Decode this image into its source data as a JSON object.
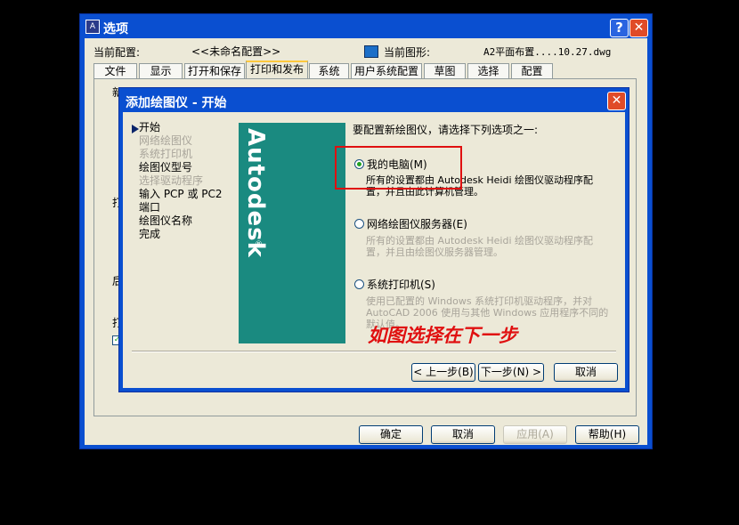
{
  "options_window": {
    "title": "选项",
    "help_btn": "?",
    "close_btn": "✕",
    "current_config_label": "当前配置:",
    "current_config_value": "<<未命名配置>>",
    "current_drawing_label": "当前图形:",
    "current_drawing_value": "A2平面布置....10.27.dwg",
    "tabs": [
      {
        "label": "文件"
      },
      {
        "label": "显示"
      },
      {
        "label": "打开和保存"
      },
      {
        "label": "打印和发布"
      },
      {
        "label": "系统"
      },
      {
        "label": "用户系统配置"
      },
      {
        "label": "草图"
      },
      {
        "label": "选择"
      },
      {
        "label": "配置"
      }
    ],
    "partial_labels": {
      "a": "新",
      "b": "打",
      "c": "后",
      "d": "打"
    },
    "buttons": {
      "ok": "确定",
      "cancel": "取消",
      "apply": "应用(A)",
      "help": "帮助(H)"
    }
  },
  "plot_dialog": {
    "title": "添加绘图仪 - 开始",
    "close_btn": "✕",
    "steps": [
      {
        "label": "开始",
        "current": true
      },
      {
        "label": "网络绘图仪",
        "dim": true
      },
      {
        "label": "系统打印机",
        "dim": true
      },
      {
        "label": "绘图仪型号",
        "dim": false
      },
      {
        "label": "选择驱动程序",
        "dim": true
      },
      {
        "label": "输入 PCP 或 PC2",
        "dim": false
      },
      {
        "label": "端口",
        "dim": false
      },
      {
        "label": "绘图仪名称",
        "dim": false
      },
      {
        "label": "完成",
        "dim": false
      }
    ],
    "banner_text": "Autodesk",
    "banner_mark": "®",
    "prompt": "要配置新绘图仪，请选择下列选项之一:",
    "options": [
      {
        "label": "我的电脑(M)",
        "selected": true,
        "desc": [
          "所有的设置都由 Autodesk Heidi 绘图仪驱动程序配",
          "置，并且由此计算机管理。"
        ]
      },
      {
        "label": "网络绘图仪服务器(E)",
        "selected": false,
        "desc": [
          "所有的设置都由 Autodesk Heidi 绘图仪驱动程序配",
          "置，并且由绘图仪服务器管理。"
        ]
      },
      {
        "label": "系统打印机(S)",
        "selected": false,
        "desc": [
          "使用已配置的 Windows 系统打印机驱动程序，并对",
          "AutoCAD 2006 使用与其他 Windows 应用程序不同的",
          "默认值。"
        ]
      }
    ],
    "annotation": "如图选择在下一步",
    "buttons": {
      "back": "< 上一步(B)",
      "next": "下一步(N) >",
      "cancel": "取消"
    }
  },
  "colors": {
    "title_bar": "#0a4fd0",
    "banner": "#1a8a80",
    "highlight_box": "#e01010",
    "annotation": "#e01010"
  }
}
